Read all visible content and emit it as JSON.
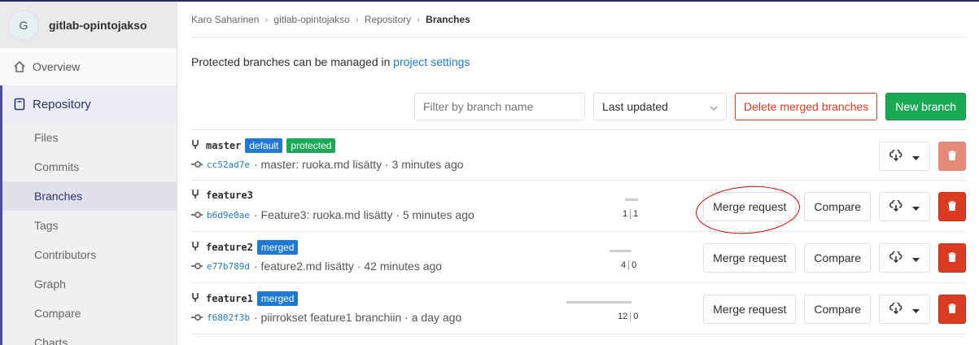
{
  "sidebar": {
    "avatar_letter": "G",
    "project_name": "gitlab-opintojakso",
    "overview_label": "Overview",
    "repository_label": "Repository",
    "sub_items": [
      "Files",
      "Commits",
      "Branches",
      "Tags",
      "Contributors",
      "Graph",
      "Compare",
      "Charts"
    ],
    "active_sub_item": "Branches"
  },
  "breadcrumb": {
    "items": [
      "Karo Saharinen",
      "gitlab-opintojakso",
      "Repository"
    ],
    "current": "Branches",
    "separator": "›"
  },
  "info": {
    "text": "Protected branches can be managed in ",
    "link": "project settings"
  },
  "controls": {
    "filter_placeholder": "Filter by branch name",
    "sort_selected": "Last updated",
    "delete_merged_label": "Delete merged branches",
    "new_branch_label": "New branch"
  },
  "branches": [
    {
      "name": "master",
      "badges": [
        "default",
        "protected"
      ],
      "sha": "cc52ad7e",
      "message": "· master: ruoka.md lisätty · 3 minutes ago",
      "behind": "",
      "ahead": "",
      "has_merge_request": false
    },
    {
      "name": "feature3",
      "badges": [],
      "sha": "b6d9e0ae",
      "message": "· Feature3: ruoka.md lisätty · 5 minutes ago",
      "behind": "1",
      "ahead": "1",
      "has_merge_request": true
    },
    {
      "name": "feature2",
      "badges": [
        "merged"
      ],
      "sha": "e77b789d",
      "message": "· feature2.md lisätty · 42 minutes ago",
      "behind": "4",
      "ahead": "0",
      "has_merge_request": true
    },
    {
      "name": "feature1",
      "badges": [
        "merged"
      ],
      "sha": "f6802f3b",
      "message": "· piirrokset feature1 branchiin · a day ago",
      "behind": "12",
      "ahead": "0",
      "has_merge_request": true
    }
  ],
  "row_actions": {
    "merge_request_label": "Merge request",
    "compare_label": "Compare"
  },
  "colors": {
    "accent": "#1f78d1",
    "green": "#1aaa55",
    "danger": "#db3b21",
    "annotation_circle": "#dd0000"
  }
}
